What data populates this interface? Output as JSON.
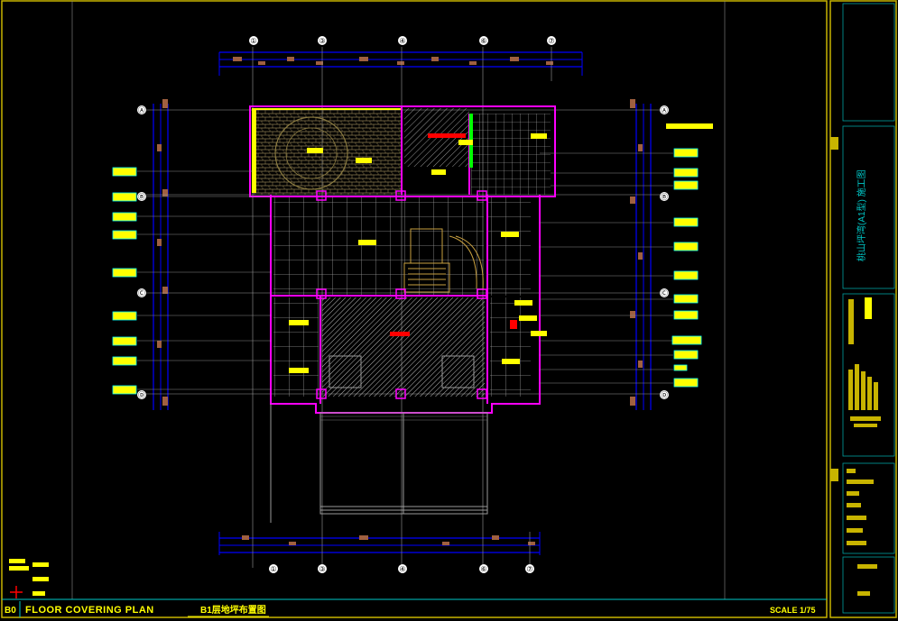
{
  "title_bar": {
    "number": "B0",
    "plan_title": "FLOOR COVERING PLAN",
    "plan_subtitle_cn": "B1层地坪布置图",
    "scale": "SCALE 1/75"
  },
  "side_panel": {
    "vertical_title_cn": "桃山坪湾(A1型) 施工图"
  },
  "grid_labels": {
    "top": [
      "①",
      "③",
      "④",
      "⑥",
      "⑦"
    ],
    "bottom": [
      "①",
      "③",
      "④",
      "⑥",
      "⑦"
    ],
    "left": [
      "Ⓐ",
      "Ⓑ",
      "Ⓒ",
      "Ⓓ"
    ],
    "right": [
      "Ⓐ",
      "Ⓑ",
      "Ⓒ",
      "Ⓓ"
    ]
  },
  "colors": {
    "background": "#000000",
    "frame": "#c8b400",
    "wall": "#ff00ff",
    "dimension": "#0000ff",
    "hatch": "#cfcfcf",
    "tag": "#ffff00",
    "accent_cyan": "#00ffff",
    "accent_red": "#ff0000"
  }
}
